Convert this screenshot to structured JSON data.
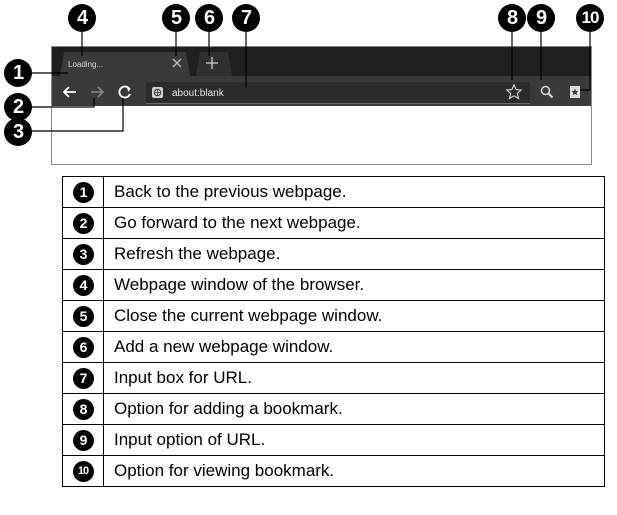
{
  "browser": {
    "tab_title": "Loading...",
    "url": "about:blank",
    "icons": [
      "close-icon",
      "plus-icon",
      "back-arrow-icon",
      "forward-arrow-icon",
      "refresh-icon",
      "globe-icon",
      "star-icon",
      "search-icon",
      "bookmark-icon"
    ]
  },
  "callouts": [
    "1",
    "2",
    "3",
    "4",
    "5",
    "6",
    "7",
    "8",
    "9",
    "10"
  ],
  "legend": [
    {
      "num": "1",
      "text": "Back to the previous webpage."
    },
    {
      "num": "2",
      "text": "Go forward to the next webpage."
    },
    {
      "num": "3",
      "text": "Refresh the webpage."
    },
    {
      "num": "4",
      "text": "Webpage window of the browser."
    },
    {
      "num": "5",
      "text": "Close the current webpage window."
    },
    {
      "num": "6",
      "text": "Add a new webpage window."
    },
    {
      "num": "7",
      "text": "Input box for URL."
    },
    {
      "num": "8",
      "text": "Option for adding a bookmark."
    },
    {
      "num": "9",
      "text": "Input option of URL."
    },
    {
      "num": "10",
      "text": "Option for viewing bookmark."
    }
  ],
  "colors": {
    "tabbar": "#1f1f1f",
    "toolbar": "#3a3a3a",
    "callout": "#000000"
  }
}
